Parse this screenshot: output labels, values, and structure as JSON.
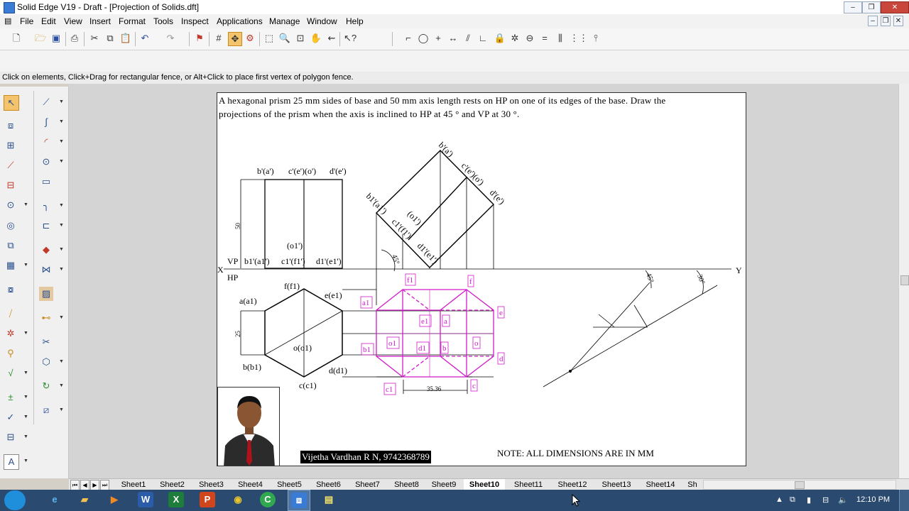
{
  "window": {
    "title": "Solid Edge V19 - Draft - [Projection of Solids.dft]",
    "controls": {
      "minimize": "–",
      "restore": "❐",
      "close": "✕",
      "inner_minimize": "–",
      "inner_restore": "❐",
      "inner_close": "✕"
    }
  },
  "menu": [
    "File",
    "Edit",
    "View",
    "Insert",
    "Format",
    "Tools",
    "Inspect",
    "Applications",
    "Manage",
    "Window",
    "Help"
  ],
  "toolbar": {
    "main_icons": [
      "new-icon",
      "open-icon",
      "save-icon",
      "print-icon",
      "cut-icon",
      "copy-icon",
      "paste-icon",
      "undo-icon",
      "redo-icon",
      "flag-icon",
      "grid-icon",
      "snap-icon",
      "intellisketch-icon",
      "zoom-area-icon",
      "zoom-icon",
      "fit-icon",
      "pan-icon",
      "zoom-previous-icon",
      "help-pointer-icon"
    ],
    "sketch_icons": [
      "line-icon",
      "circle-icon",
      "point-icon",
      "horizontal-vertical-icon",
      "parallel-icon",
      "perpendicular-icon",
      "lock-icon",
      "connect-icon",
      "tangent-icon",
      "equal-icon",
      "symmetric-icon",
      "collinear-icon",
      "relationship-handles-icon"
    ]
  },
  "prompt": "Click on elements, Click+Drag for rectangular fence, or Alt+Click to place first vertex of polygon fence.",
  "left_tools": [
    "select-tool-icon",
    "line-icon",
    "part-view-icon",
    "curve-icon",
    "principal-view-icon",
    "arc-icon",
    "auxiliary-view-icon",
    "circle-icon",
    "section-view-icon",
    "rectangle-icon",
    "detail-view-icon",
    "fillet-icon",
    "broken-view-icon",
    "chamfer-icon",
    "draft-view-icon",
    "fill-icon",
    "update-view-icon",
    "offset-icon",
    "view-properties-icon",
    "trim-icon",
    "layer-icon",
    "hatch-icon",
    "symbol-icon",
    "dimension-icon",
    "balloon-icon",
    "3d-model-icon",
    "feature-control-icon",
    "mirror-icon",
    "datum-icon",
    "rotate-icon",
    "weld-icon",
    "block-icon",
    "text-icon"
  ],
  "drawing": {
    "problem_line1": "A hexagonal prism 25 mm sides of base and 50 mm axis length rests on HP on one of its edges of the base. Draw the",
    "problem_line2": "projections of the prism when the axis is inclined to HP at 45 ° and VP at 30 °.",
    "labels": {
      "top_b": "b'(a')",
      "top_c": "c'(e')(o')",
      "top_d": "d'(e')",
      "dim_50": "50",
      "o1p": "(o1')",
      "vp": "VP",
      "hp": "HP",
      "x": "X",
      "y": "Y",
      "b1a1": "b1'(a1')",
      "c1f1": "c1'(f1')",
      "d1e1": "d1'(e1')",
      "f_f1": "f(f1)",
      "e_e1": "e(e1)",
      "a_a1": "a(a1)",
      "dim_25": "25",
      "o_o1": "o(o1)",
      "b_b1": "b(b1)",
      "d_d1": "d(d1)",
      "c_c1": "c(c1)",
      "r_b": "b'(a')",
      "r_c": "c'(e')(o')",
      "r_d": "d'(e')",
      "r_b1": "b1'(a1')",
      "r_o1": "(o1')",
      "r_c1": "c1'(f1')",
      "r_d1": "d1'(e1')",
      "ang45": "45°",
      "p_f1": "f1",
      "p_f": "f",
      "p_a1": "a1",
      "p_e": "e",
      "p_e1": "e1",
      "p_a": "a",
      "p_b1": "b1",
      "p_o1": "o1",
      "p_d1": "d1",
      "p_b": "b",
      "p_o": "o",
      "p_d": "d",
      "p_c1": "c1",
      "p_c": "c",
      "dim_3536": "35.36",
      "aux45": "45°",
      "aux30": "30°"
    },
    "author": "Vijetha Vardhan R N, 9742368789",
    "note": "NOTE: ALL DIMENSIONS ARE IN MM",
    "magenta": "#d11ac8"
  },
  "sheets": [
    "Sheet1",
    "Sheet2",
    "Sheet3",
    "Sheet4",
    "Sheet5",
    "Sheet6",
    "Sheet7",
    "Sheet8",
    "Sheet9",
    "Sheet10",
    "Sheet11",
    "Sheet12",
    "Sheet13",
    "Sheet14",
    "Sh"
  ],
  "active_sheet": "Sheet10",
  "taskbar": {
    "apps": [
      "ie-icon",
      "folder-icon",
      "media-player-icon",
      "word-icon",
      "excel-icon",
      "powerpoint-icon",
      "chrome-icon",
      "app-green-icon",
      "solid-edge-icon",
      "notes-icon"
    ],
    "clock": "12:10 PM"
  }
}
